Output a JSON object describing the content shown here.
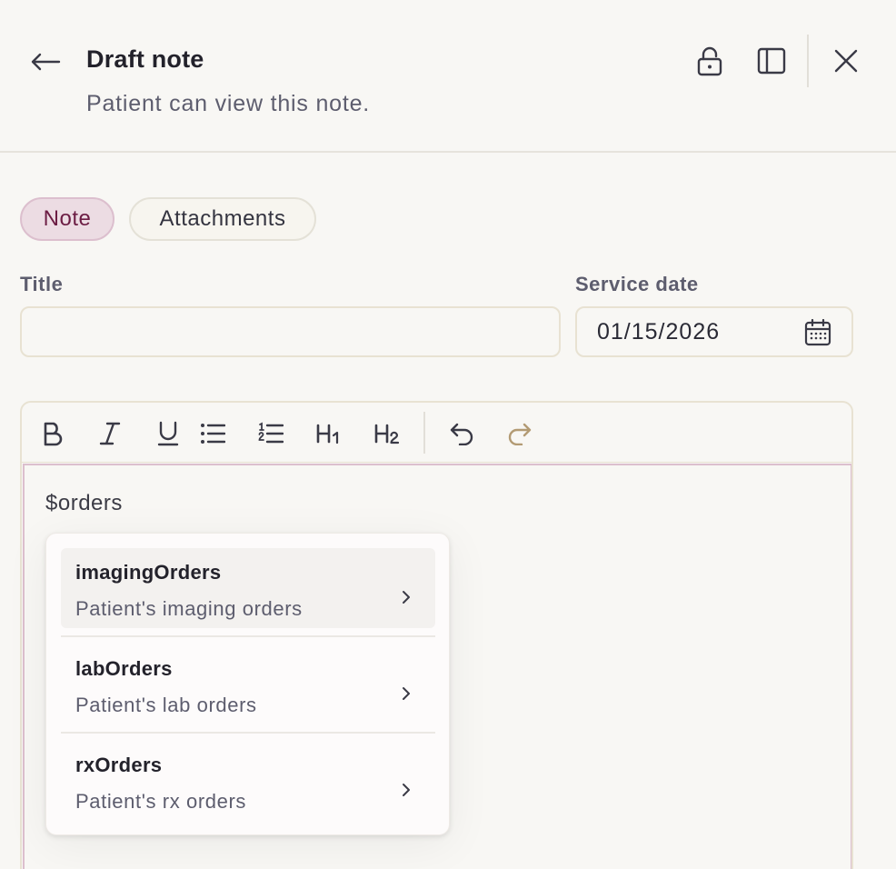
{
  "header": {
    "title": "Draft note",
    "subtitle": "Patient can view this note.",
    "icons": [
      "back-arrow-icon",
      "lock-icon",
      "sidebar-panel-icon",
      "close-icon"
    ]
  },
  "tabs": [
    {
      "label": "Note",
      "active": true
    },
    {
      "label": "Attachments",
      "active": false
    }
  ],
  "form": {
    "title_label": "Title",
    "title_value": "",
    "service_date_label": "Service date",
    "service_date_value": "01/15/2026"
  },
  "toolbar": {
    "buttons": [
      "bold",
      "italic",
      "underline",
      "bullet-list",
      "numbered-list",
      "heading-1",
      "heading-2",
      "undo",
      "redo"
    ],
    "h1_label": "H1",
    "h2_label": "H2"
  },
  "editor": {
    "content": "$orders"
  },
  "suggestions": [
    {
      "name": "imagingOrders",
      "description": "Patient's imaging orders",
      "highlighted": true
    },
    {
      "name": "labOrders",
      "description": "Patient's lab orders",
      "highlighted": false
    },
    {
      "name": "rxOrders",
      "description": "Patient's rx orders",
      "highlighted": false
    }
  ],
  "colors": {
    "background": "#f8f7f4",
    "accent": "#6c1d44",
    "accent_bg": "#ecdce3",
    "redo_icon": "#b39b74"
  }
}
